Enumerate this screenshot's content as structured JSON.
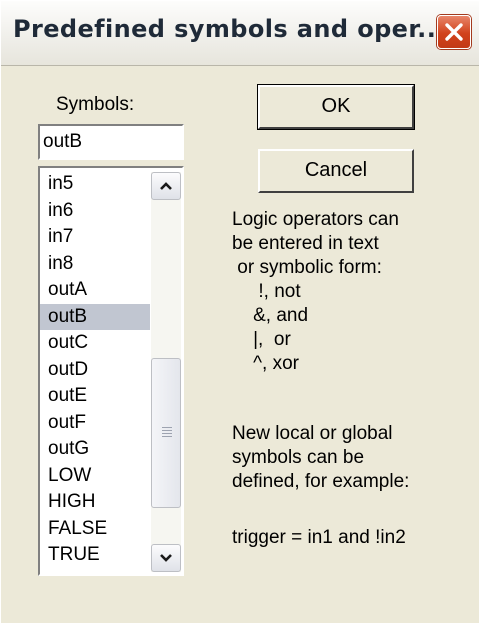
{
  "window": {
    "title": "Predefined symbols and oper...",
    "close_icon": "close-icon"
  },
  "symbols": {
    "label": "Symbols:",
    "input_value": "outB",
    "items": [
      "in5",
      "in6",
      "in7",
      "in8",
      "outA",
      "outB",
      "outC",
      "outD",
      "outE",
      "outF",
      "outG",
      "LOW",
      "HIGH",
      "FALSE",
      "TRUE"
    ],
    "selected": "outB"
  },
  "buttons": {
    "ok": "OK",
    "cancel": "Cancel"
  },
  "help": {
    "lines1": [
      "Logic operators can",
      "be entered in text",
      " or symbolic form:",
      "     !, not",
      "    &, and",
      "    |,  or",
      "    ^, xor"
    ],
    "lines2": [
      "New local or global",
      "symbols can be",
      "defined, for example:"
    ],
    "example": "trigger = in1 and !in2"
  },
  "colors": {
    "dialog_bg": "#ece9d8",
    "selection": "#c1c6d1",
    "close_button": "#d1421c"
  }
}
